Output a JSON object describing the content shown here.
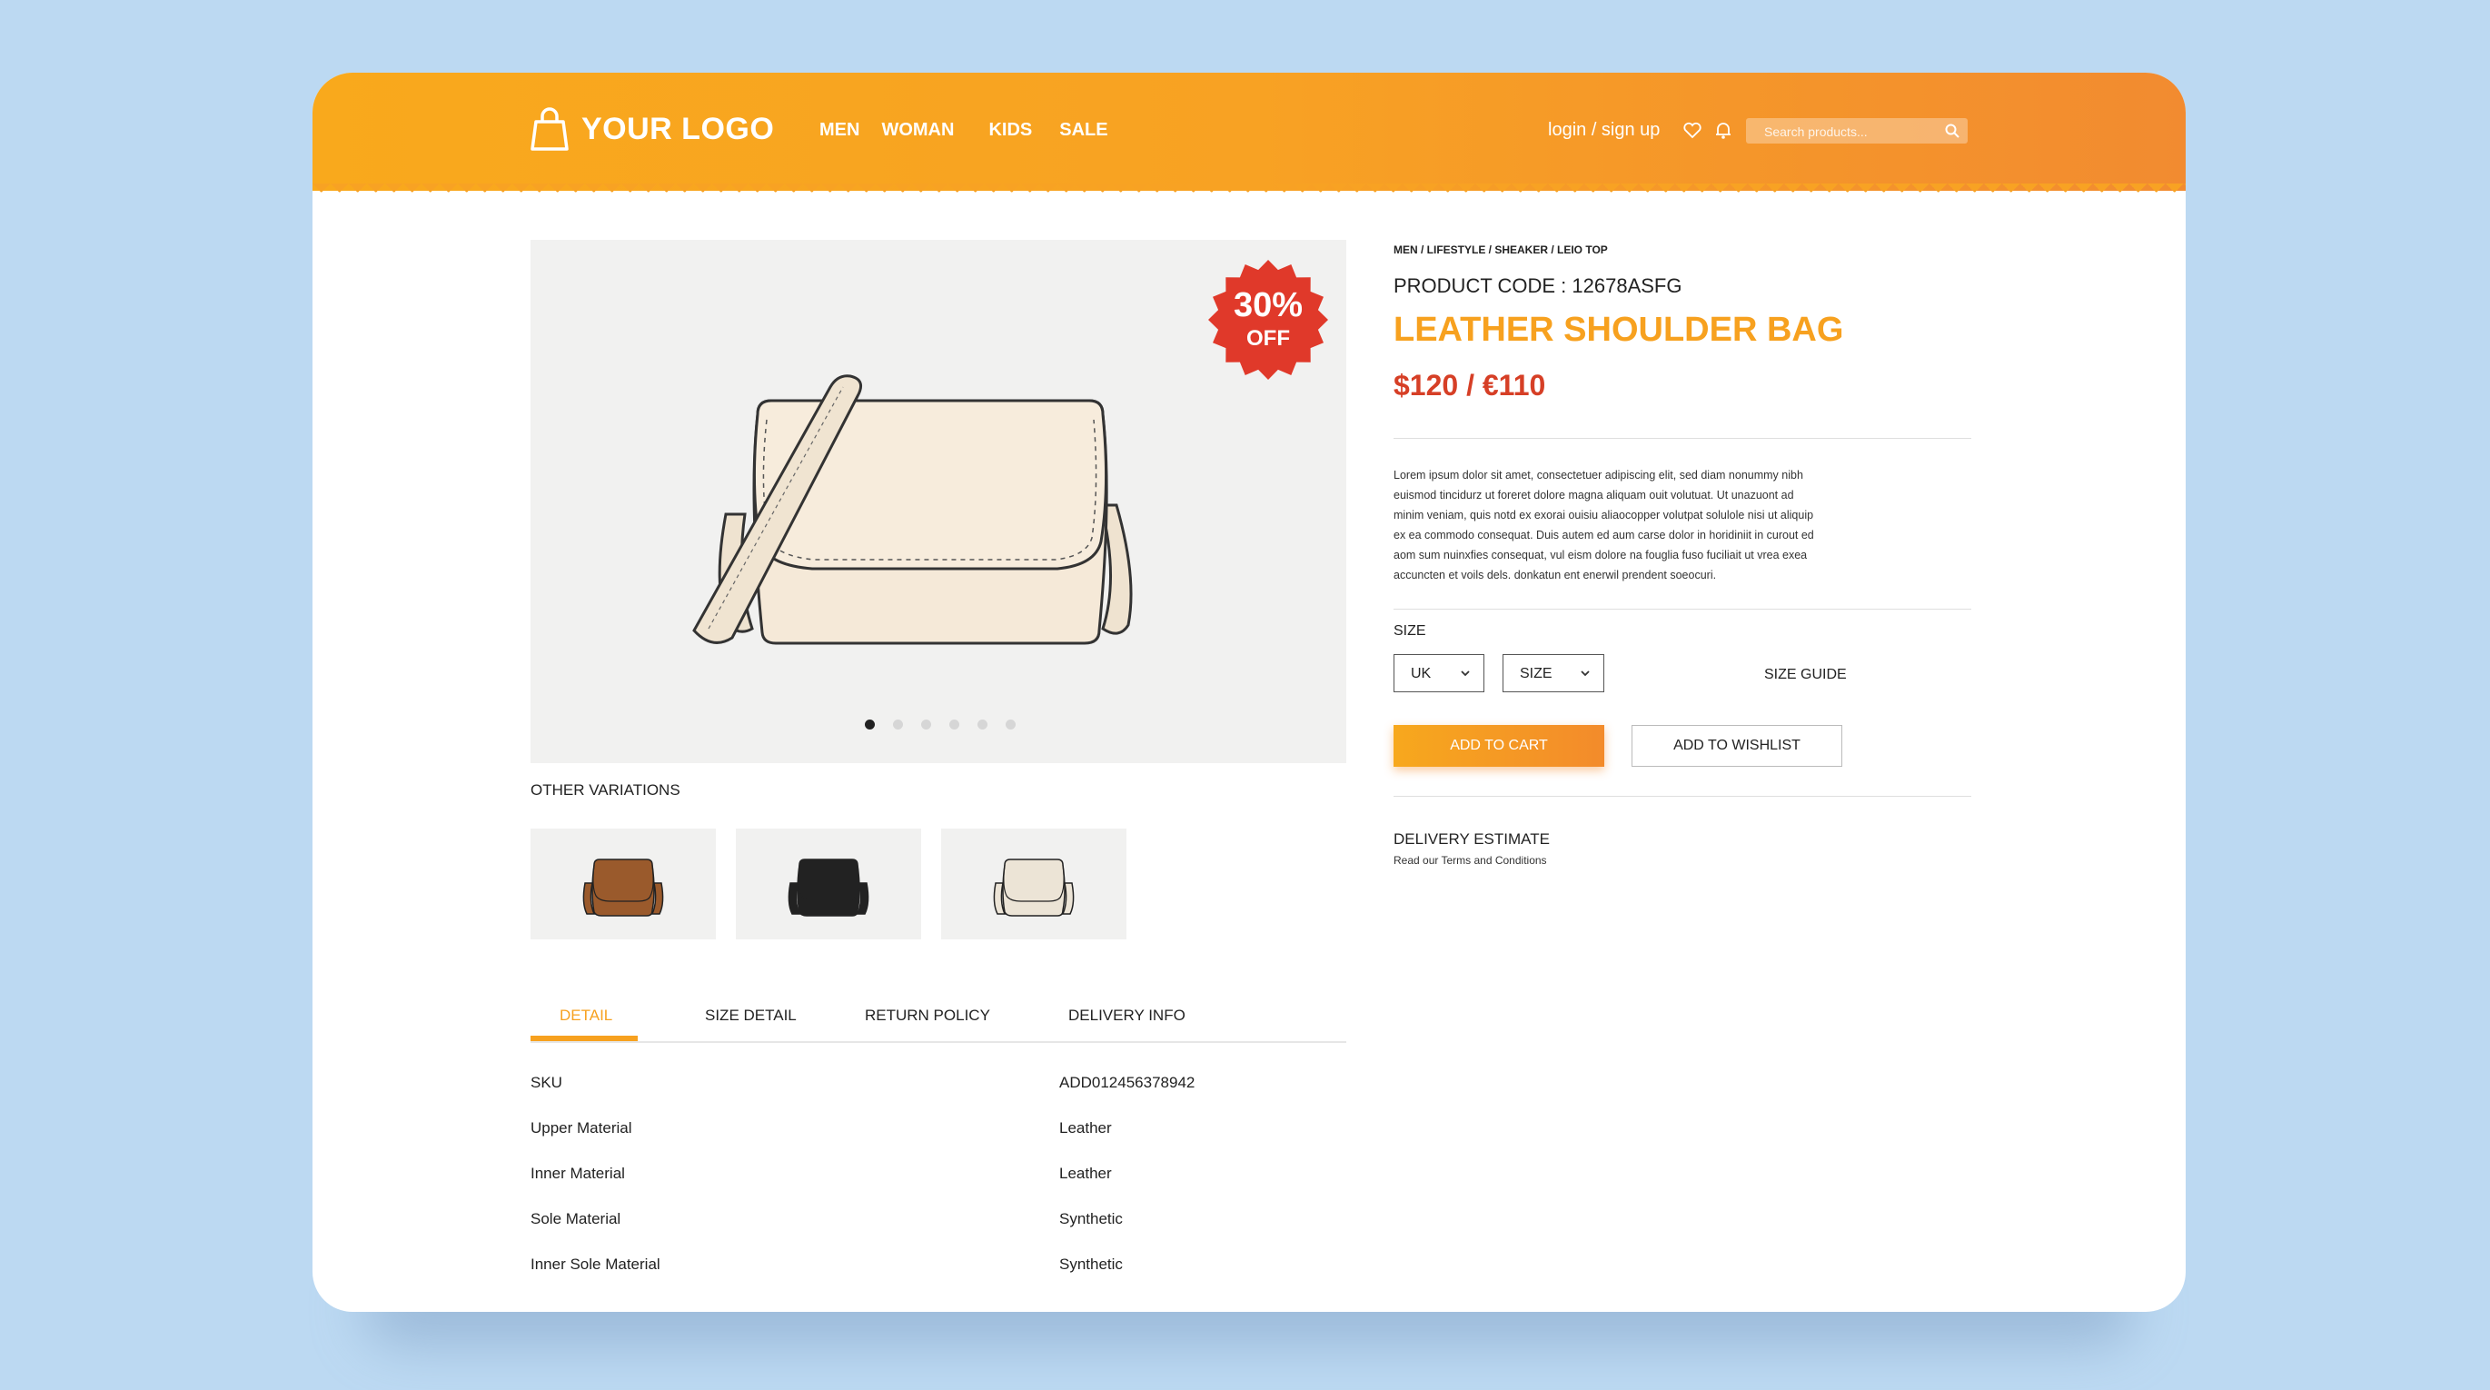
{
  "header": {
    "logo_text": "YOUR LOGO",
    "nav": [
      "MEN",
      "WOMAN",
      "KIDS",
      "SALE"
    ],
    "login_text": "login / sign up",
    "search_placeholder": "Search products..."
  },
  "product": {
    "badge_percent": "30%",
    "badge_off": "OFF",
    "carousel": {
      "total": 6,
      "active": 1
    },
    "other_variations_label": "OTHER VARIATIONS",
    "variations": [
      {
        "name": "brown",
        "color": "#9a5a2c"
      },
      {
        "name": "black",
        "color": "#222222"
      },
      {
        "name": "cream",
        "color": "#ece4d6"
      }
    ],
    "breadcrumb": "MEN / LIFESTYLE / SHEAKER / LEIO TOP",
    "code": "PRODUCT CODE : 12678ASFG",
    "title": "LEATHER SHOULDER BAG",
    "price": "$120 / €110",
    "description": "Lorem ipsum dolor sit amet, consectetuer adipiscing elit, sed diam nonummy nibh euismod tincidurz ut foreret dolore magna aliquam ouit volutuat. Ut unazuont ad minim veniam, quis notd ex exorai ouisiu aliaocopper volutpat solulole nisi ut aliquip ex ea commodo consequat. Duis autem ed aum carse dolor in horidiniit in curout ed aom sum nuinxfies consequat, vul eism dolore na fouglia fuso fuciliait ut vrea exea accuncten et voils dels. donkatun ent enerwil prendent soeocuri.",
    "size_label": "SIZE",
    "size_region": "UK",
    "size_value": "SIZE",
    "size_guide": "SIZE GUIDE",
    "add_to_cart": "ADD TO CART",
    "add_to_wishlist": "ADD TO WISHLIST",
    "delivery_estimate": "DELIVERY ESTIMATE",
    "terms": "Read our Terms and Conditions"
  },
  "tabs": {
    "items": [
      "DETAIL",
      "SIZE DETAIL",
      "RETURN POLICY",
      "DELIVERY INFO"
    ],
    "active": "DETAIL"
  },
  "details": [
    {
      "label": "SKU",
      "value": "ADD012456378942"
    },
    {
      "label": "Upper Material",
      "value": "Leather"
    },
    {
      "label": "Inner Material",
      "value": "Leather"
    },
    {
      "label": "Sole Material",
      "value": "Synthetic"
    },
    {
      "label": "Inner Sole Material",
      "value": "Synthetic"
    }
  ],
  "colors": {
    "accent": "#f7a11f",
    "header_end": "#f28b30",
    "price": "#d63f26",
    "badge": "#e0392a",
    "background": "#bcd9f2"
  }
}
